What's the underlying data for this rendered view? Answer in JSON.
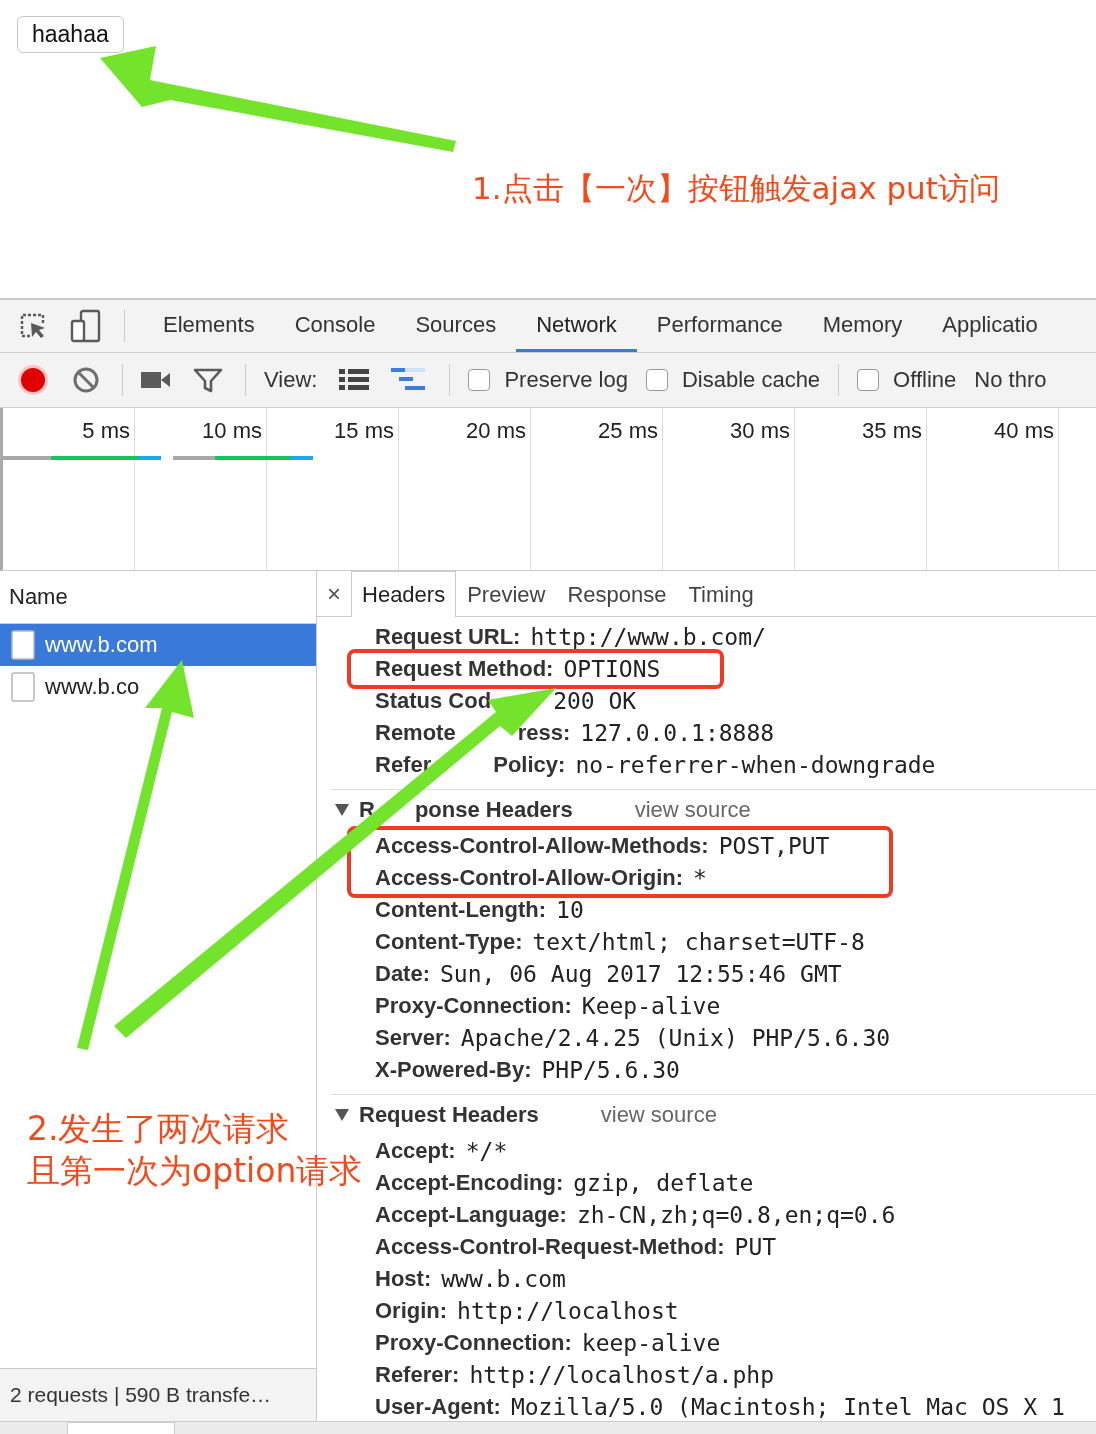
{
  "page_button": "haahaa",
  "annotations": [
    {
      "kind": "note1",
      "lines": [
        "1.点击【一次】按钮触发ajax put访问"
      ]
    },
    {
      "kind": "note2",
      "lines": [
        "2.发生了两次请求",
        "且第一次为option请求"
      ]
    }
  ],
  "devtools": {
    "panel_tabs": [
      {
        "label": "Elements",
        "selected": false
      },
      {
        "label": "Console",
        "selected": false
      },
      {
        "label": "Sources",
        "selected": false
      },
      {
        "label": "Network",
        "selected": true
      },
      {
        "label": "Performance",
        "selected": false
      },
      {
        "label": "Memory",
        "selected": false
      },
      {
        "label": "Applicatio",
        "selected": false
      }
    ],
    "toolbar": {
      "recording": true,
      "view_label": "View:",
      "checkboxes": [
        {
          "label": "Preserve log",
          "checked": false
        },
        {
          "label": "Disable cache",
          "checked": false
        },
        {
          "label": "Offline",
          "checked": false
        }
      ],
      "throttle": "No thro"
    },
    "timeline": {
      "ticks": [
        "5 ms",
        "10 ms",
        "15 ms",
        "20 ms",
        "25 ms",
        "30 ms",
        "35 ms",
        "40 ms"
      ]
    },
    "requests": {
      "column": "Name",
      "rows": [
        {
          "name": "www.b.com",
          "selected": true
        },
        {
          "name": "www.b.co",
          "selected": false
        }
      ],
      "status": "2 requests | 590 B transfe…"
    },
    "detail": {
      "close": "×",
      "tabs": [
        {
          "label": "Headers",
          "selected": true
        },
        {
          "label": "Preview",
          "selected": false
        },
        {
          "label": "Response",
          "selected": false
        },
        {
          "label": "Timing",
          "selected": false
        }
      ],
      "general": [
        {
          "key": "Request URL:",
          "value": "http://www.b.com/",
          "boxed": false
        },
        {
          "key": "Request Method:",
          "value": "OPTIONS",
          "boxed": true
        },
        {
          "key_parts": [
            "Status Cod"
          ],
          "value": "200 OK",
          "boxed": false
        },
        {
          "key_parts": [
            "Remote",
            "ress:"
          ],
          "value": "127.0.0.1:8888",
          "boxed": false
        },
        {
          "key_parts": [
            "Refer",
            "Policy:"
          ],
          "value": "no-referrer-when-downgrade",
          "boxed": false
        }
      ],
      "sections": [
        {
          "title_parts": [
            "R",
            "ponse Headers"
          ],
          "view_source": "view source",
          "expanded": true,
          "rows": [
            {
              "key": "Access-Control-Allow-Methods:",
              "value": "POST,PUT",
              "boxed": true
            },
            {
              "key": "Access-Control-Allow-Origin:",
              "value": "*",
              "boxed": true
            },
            {
              "key": "Content-Length:",
              "value": "10",
              "boxed": false
            },
            {
              "key": "Content-Type:",
              "value": "text/html; charset=UTF-8",
              "boxed": false
            },
            {
              "key": "Date:",
              "value": "Sun, 06 Aug 2017 12:55:46 GMT",
              "boxed": false
            },
            {
              "key": "Proxy-Connection:",
              "value": "Keep-alive",
              "boxed": false
            },
            {
              "key": "Server:",
              "value": "Apache/2.4.25 (Unix) PHP/5.6.30",
              "boxed": false
            },
            {
              "key": "X-Powered-By:",
              "value": "PHP/5.6.30",
              "boxed": false
            }
          ]
        },
        {
          "title_parts": [
            "Request Headers"
          ],
          "view_source": "view source",
          "expanded": true,
          "rows": [
            {
              "key": "Accept:",
              "value": "*/*",
              "boxed": false
            },
            {
              "key": "Accept-Encoding:",
              "value": "gzip, deflate",
              "boxed": false
            },
            {
              "key": "Accept-Language:",
              "value": "zh-CN,zh;q=0.8,en;q=0.6",
              "boxed": false
            },
            {
              "key": "Access-Control-Request-Method:",
              "value": "PUT",
              "boxed": false
            },
            {
              "key": "Host:",
              "value": "www.b.com",
              "boxed": false
            },
            {
              "key": "Origin:",
              "value": "http://localhost",
              "boxed": false
            },
            {
              "key": "Proxy-Connection:",
              "value": "keep-alive",
              "boxed": false
            },
            {
              "key": "Referer:",
              "value": "http://localhost/a.php",
              "boxed": false
            },
            {
              "key": "User-Agent:",
              "value": "Mozilla/5.0 (Macintosh; Intel Mac OS X 1",
              "boxed": false
            }
          ]
        }
      ]
    }
  }
}
